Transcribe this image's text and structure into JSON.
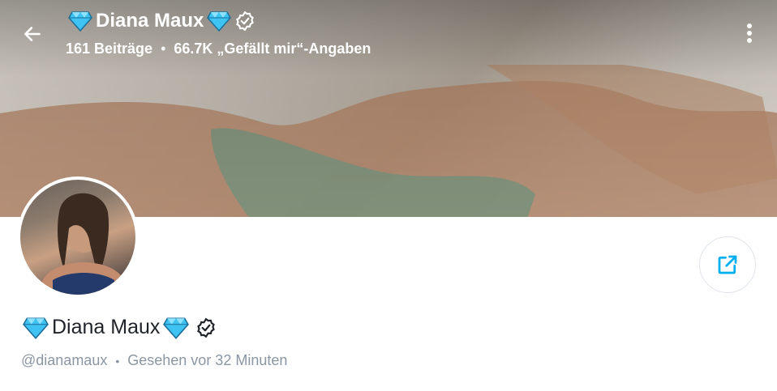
{
  "header": {
    "name": "Diana Maux",
    "posts": "161 Beiträge",
    "separator": "•",
    "likes": "66.7K „Gefällt mir“-Angaben"
  },
  "profile": {
    "name": "Diana Maux",
    "handle": "@dianamaux",
    "separator": "•",
    "last_seen": "Gesehen vor 32 Minuten"
  },
  "icons": {
    "back": "arrow-left-icon",
    "more": "more-vertical-icon",
    "share": "share-icon",
    "verified": "verified-badge-icon",
    "diamond": "diamond-emoji-icon"
  },
  "colors": {
    "accent": "#00aff0",
    "text": "#1f2329",
    "muted": "#8a96a3",
    "diamond": "#3ec3f2"
  }
}
